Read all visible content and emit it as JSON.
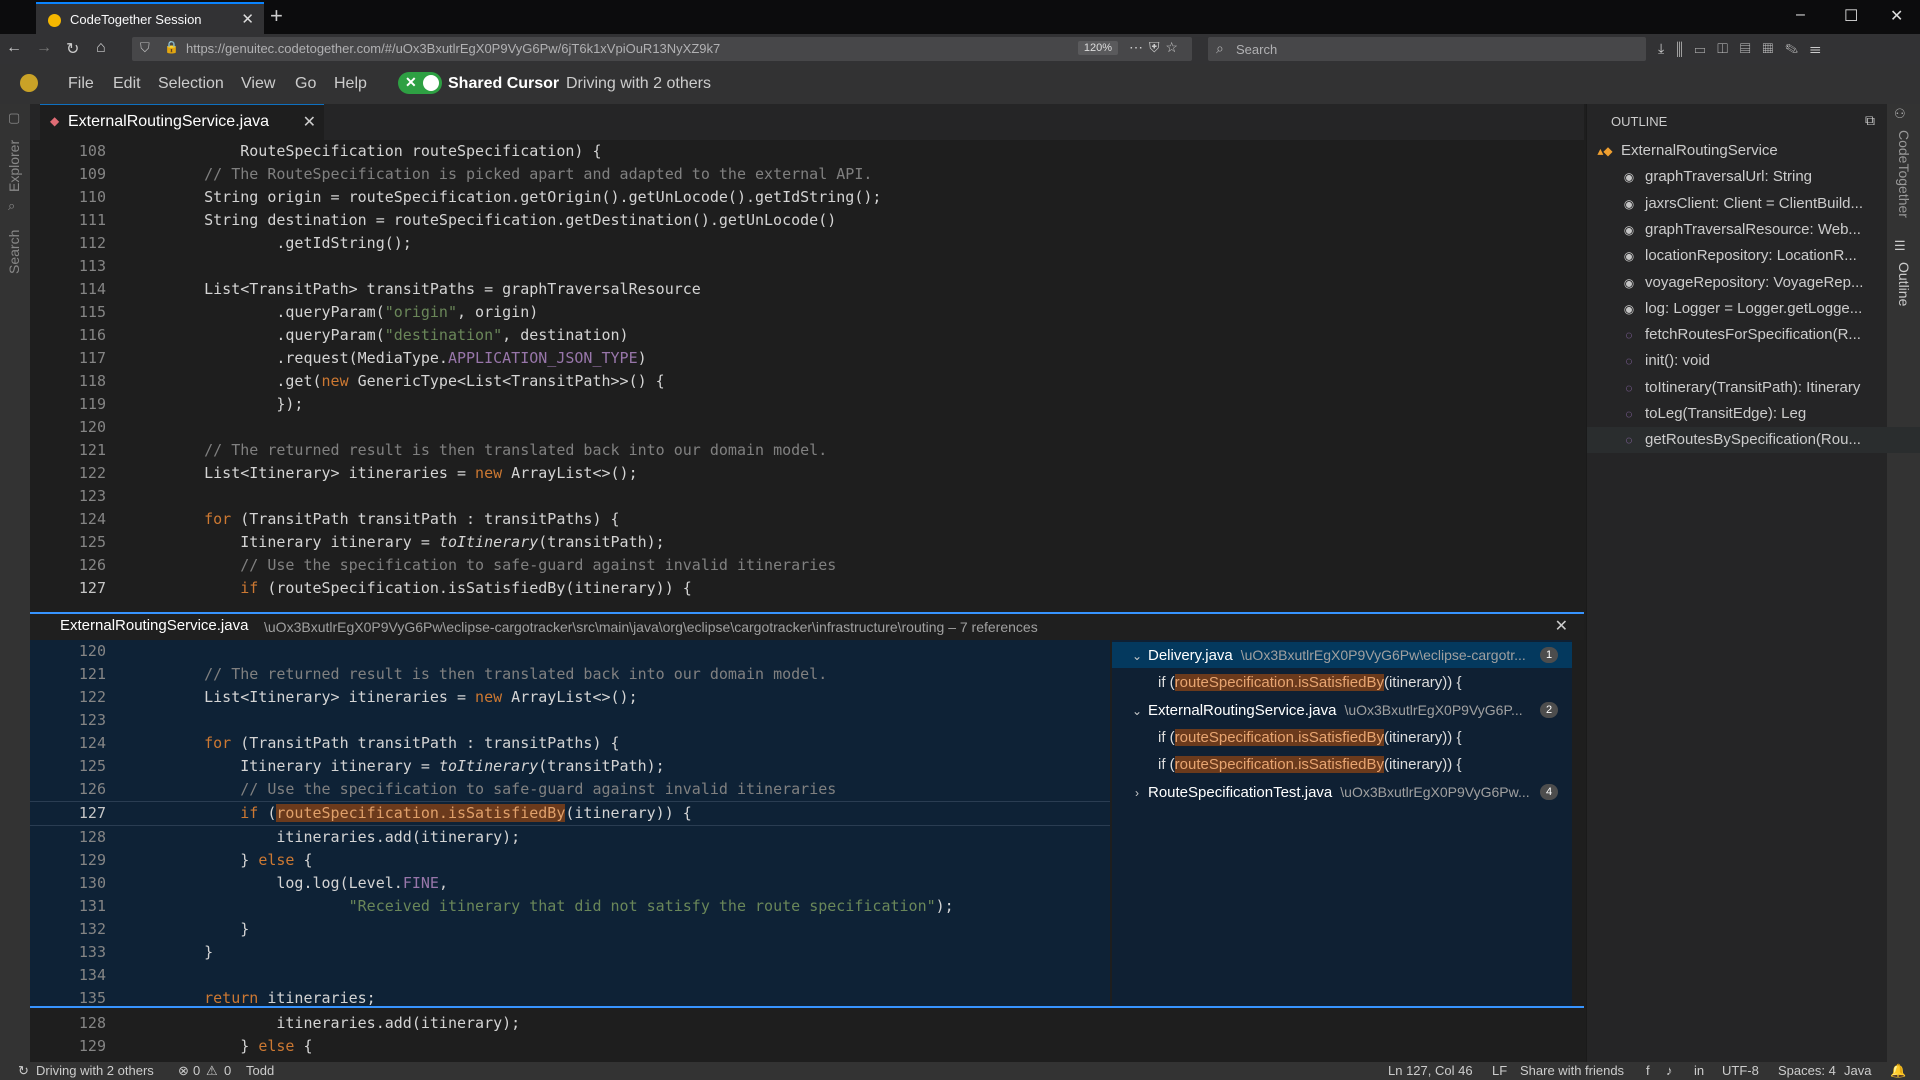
{
  "browser": {
    "tab_title": "CodeTogether Session",
    "new_tab": "+",
    "url": "https://genuitec.codetogether.com/#/uOx3BxutlrEgX0P9VyG6Pw/6jT6k1xVpiOuR13NyXZ9k7",
    "zoom": "120%",
    "search_placeholder": "Search",
    "window_controls": [
      "–",
      "☐",
      "✕"
    ]
  },
  "menubar": {
    "items": [
      "File",
      "Edit",
      "Selection",
      "View",
      "Go",
      "Help"
    ],
    "shared_cursor_label": "Shared Cursor",
    "driving_status": "Driving with 2 others"
  },
  "activity_left": [
    "Explorer",
    "Search"
  ],
  "activity_right": [
    "CodeTogether",
    "Outline"
  ],
  "editor": {
    "tab_label": "ExternalRoutingService.java",
    "active_line": 127
  },
  "peek": {
    "file": "ExternalRoutingService.java",
    "path": "\\uOx3BxutlrEgX0P9VyG6Pw\\eclipse-cargotracker\\src\\main\\java\\org\\eclipse\\cargotracker\\infrastructure\\routing – 7 references",
    "references": [
      {
        "file": "Delivery.java",
        "dir": "\\uOx3BxutlrEgX0P9VyG6Pw\\eclipse-cargotr...",
        "count": "1",
        "expanded": true,
        "lines": [
          "routeSpecification.isSatisfiedBy"
        ]
      },
      {
        "file": "ExternalRoutingService.java",
        "dir": "\\uOx3BxutlrEgX0P9VyG6P...",
        "count": "2",
        "expanded": true,
        "lines": [
          "routeSpecification.isSatisfiedBy",
          "routeSpecification.isSatisfiedBy"
        ]
      },
      {
        "file": "RouteSpecificationTest.java",
        "dir": "\\uOx3BxutlrEgX0P9VyG6Pw...",
        "count": "4",
        "expanded": false,
        "lines": []
      }
    ],
    "ref_prefix": "if (",
    "ref_suffix": "(itinerary)) {"
  },
  "outline": {
    "header": "OUTLINE",
    "items": [
      {
        "label": "ExternalRoutingService",
        "kind": "class"
      },
      {
        "label": "graphTraversalUrl: String",
        "kind": "field"
      },
      {
        "label": "jaxrsClient: Client = ClientBuild...",
        "kind": "field"
      },
      {
        "label": "graphTraversalResource: Web...",
        "kind": "field"
      },
      {
        "label": "locationRepository: LocationR...",
        "kind": "field"
      },
      {
        "label": "voyageRepository: VoyageRep...",
        "kind": "field"
      },
      {
        "label": "log: Logger = Logger.getLogge...",
        "kind": "field"
      },
      {
        "label": "fetchRoutesForSpecification(R...",
        "kind": "method"
      },
      {
        "label": "init(): void",
        "kind": "method"
      },
      {
        "label": "toItinerary(TransitPath): Itinerary",
        "kind": "method"
      },
      {
        "label": "toLeg(TransitEdge): Leg",
        "kind": "method"
      },
      {
        "label": "getRoutesBySpecification(Rou...",
        "kind": "method"
      }
    ]
  },
  "status": {
    "driving": "Driving with 2 others",
    "errors": "0",
    "warnings": "0",
    "user": "Todd",
    "position": "Ln 127, Col 46",
    "eol": "LF",
    "share": "Share with friends",
    "encoding": "UTF-8",
    "indent": "Spaces: 4",
    "language": "Java"
  },
  "code_top": [
    {
      "n": "108",
      "code": "        RouteSpecification routeSpecification) {"
    },
    {
      "n": "109",
      "code": "    // The RouteSpecification is picked apart and adapted to the external API."
    },
    {
      "n": "110",
      "code": "    String origin = routeSpecification.getOrigin().getUnLocode().getIdString();"
    },
    {
      "n": "111",
      "code": "    String destination = routeSpecification.getDestination().getUnLocode()"
    },
    {
      "n": "112",
      "code": "            .getIdString();"
    },
    {
      "n": "113",
      "code": ""
    },
    {
      "n": "114",
      "code": "    List<TransitPath> transitPaths = graphTraversalResource"
    },
    {
      "n": "115",
      "code": "            .queryParam(\"origin\", origin)"
    },
    {
      "n": "116",
      "code": "            .queryParam(\"destination\", destination)"
    },
    {
      "n": "117",
      "code": "            .request(MediaType.APPLICATION_JSON_TYPE)"
    },
    {
      "n": "118",
      "code": "            .get(new GenericType<List<TransitPath>>() {"
    },
    {
      "n": "119",
      "code": "            });"
    },
    {
      "n": "120",
      "code": ""
    },
    {
      "n": "121",
      "code": "    // The returned result is then translated back into our domain model."
    },
    {
      "n": "122",
      "code": "    List<Itinerary> itineraries = new ArrayList<>();"
    },
    {
      "n": "123",
      "code": ""
    },
    {
      "n": "124",
      "code": "    for (TransitPath transitPath : transitPaths) {"
    },
    {
      "n": "125",
      "code": "        Itinerary itinerary = toItinerary(transitPath);"
    },
    {
      "n": "126",
      "code": "        // Use the specification to safe-guard against invalid itineraries"
    },
    {
      "n": "127",
      "code": "        if (routeSpecification.isSatisfiedBy(itinerary)) {"
    }
  ],
  "code_peek": [
    {
      "n": "120",
      "code": ""
    },
    {
      "n": "121",
      "code": "    // The returned result is then translated back into our domain model."
    },
    {
      "n": "122",
      "code": "    List<Itinerary> itineraries = new ArrayList<>();"
    },
    {
      "n": "123",
      "code": ""
    },
    {
      "n": "124",
      "code": "    for (TransitPath transitPath : transitPaths) {"
    },
    {
      "n": "125",
      "code": "        Itinerary itinerary = toItinerary(transitPath);"
    },
    {
      "n": "126",
      "code": "        // Use the specification to safe-guard against invalid itineraries"
    },
    {
      "n": "127",
      "code": "        if (routeSpecification.isSatisfiedBy(itinerary)) {"
    },
    {
      "n": "128",
      "code": "            itineraries.add(itinerary);"
    },
    {
      "n": "129",
      "code": "        } else {"
    },
    {
      "n": "130",
      "code": "            log.log(Level.FINE,"
    },
    {
      "n": "131",
      "code": "                    \"Received itinerary that did not satisfy the route specification\");"
    },
    {
      "n": "132",
      "code": "        }"
    },
    {
      "n": "133",
      "code": "    }"
    },
    {
      "n": "134",
      "code": ""
    },
    {
      "n": "135",
      "code": "    return itineraries;"
    }
  ],
  "code_bottom": [
    {
      "n": "128",
      "code": "            itineraries.add(itinerary);"
    },
    {
      "n": "129",
      "code": "        } else {"
    }
  ]
}
